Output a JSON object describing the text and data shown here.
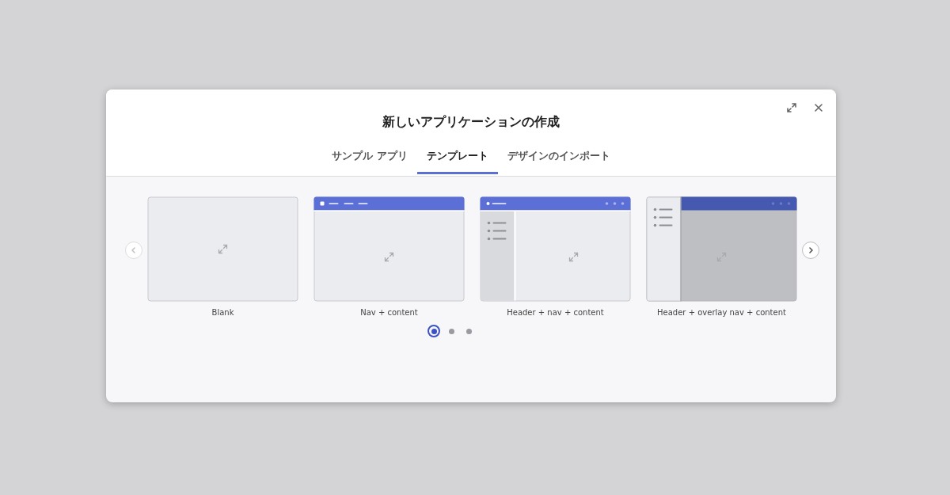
{
  "dialog": {
    "title": "新しいアプリケーションの作成"
  },
  "tabs": [
    {
      "label": "サンプル アプリ",
      "selected": false
    },
    {
      "label": "テンプレート",
      "selected": true
    },
    {
      "label": "デザインのインポート",
      "selected": false
    }
  ],
  "carousel": {
    "prev_disabled": true,
    "next_disabled": false
  },
  "templates": [
    {
      "kind": "blank",
      "label": "Blank"
    },
    {
      "kind": "nav",
      "label": "Nav + content"
    },
    {
      "kind": "header-nav",
      "label": "Header + nav + content"
    },
    {
      "kind": "overlay-nav",
      "label": "Header + overlay nav + content"
    }
  ],
  "pages": [
    {
      "selected": true
    },
    {
      "selected": false
    },
    {
      "selected": false
    }
  ]
}
